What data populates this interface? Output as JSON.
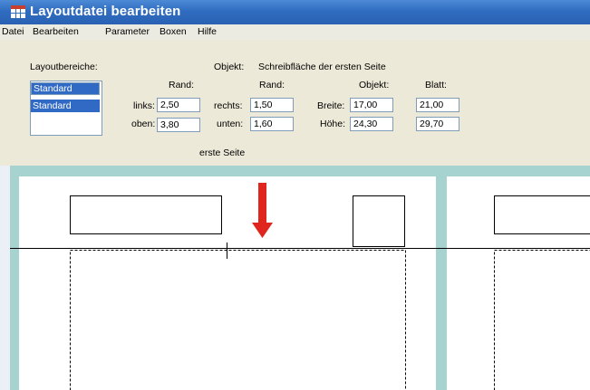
{
  "window": {
    "title": "Layoutdatei bearbeiten",
    "icon": "table-app-icon"
  },
  "menu": [
    "Datei",
    "Bearbeiten",
    "Parameter",
    "Boxen",
    "Hilfe"
  ],
  "panel": {
    "layout_areas_label": "Layoutbereiche:",
    "layout_selected": "Standard",
    "layout_items": [
      "Standard"
    ],
    "object_label": "Objekt:",
    "object_value": "Schreibfläche der ersten Seite",
    "margin_header_1": "Rand:",
    "margin_header_2": "Rand:",
    "object_header": "Objekt:",
    "sheet_header": "Blatt:",
    "left_label": "links:",
    "left_value": "2,50",
    "top_label": "oben:",
    "top_value": "3,80",
    "right_label": "rechts:",
    "right_value": "1,50",
    "bottom_label": "unten:",
    "bottom_value": "1,60",
    "width_label": "Breite:",
    "object_width": "17,00",
    "sheet_width": "21,00",
    "height_label": "Höhe:",
    "object_height": "24,30",
    "sheet_height": "29,70",
    "page_caption": "erste Seite"
  },
  "colors": {
    "titlebar": "#2f6cc0",
    "canvas": "#a6d2d0",
    "selection": "#316ac5",
    "arrow": "#e0251f"
  }
}
